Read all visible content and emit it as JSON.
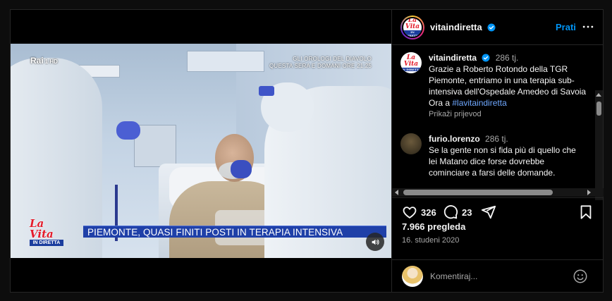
{
  "video": {
    "channel_logo": "Rai",
    "channel_suffix": "1 HD",
    "promo_line1": "GLI OROLOGI DEL DIAVOLO",
    "promo_line2": "QUESTA SERA E DOMANI ORE 21:25",
    "show_logo_word": "La Vita",
    "show_logo_sub": "IN DIRETTA",
    "banner": "PIEMONTE, QUASI FINITI POSTI IN TERAPIA INTENSIVA",
    "sound_icon": "speaker-icon"
  },
  "header": {
    "username": "vitaindiretta",
    "verified_icon": "verified-badge-icon",
    "follow_label": "Prati",
    "more_icon": "more-horizontal-icon"
  },
  "caption": {
    "username": "vitaindiretta",
    "time": "286 tj.",
    "text": "Grazie a Roberto Rotondo della TGR Piemonte, entriamo in una terapia sub-intensiva dell'Ospedale Amedeo di Savoia Ora a ",
    "hashtag": "#lavitaindiretta",
    "translate_label": "Prikaži prijevod"
  },
  "comments": [
    {
      "username": "furio.lorenzo",
      "time": "286 tj.",
      "text": "Se la gente non si fida più di quello che lei Matano dice forse dovrebbe cominciare a farsi delle domande."
    }
  ],
  "actions": {
    "likes": "326",
    "comments": "23",
    "icons": [
      "heart-icon",
      "comment-icon",
      "share-icon",
      "bookmark-icon"
    ]
  },
  "stats": {
    "views": "7.966 pregleda",
    "date": "16. studeni 2020"
  },
  "comment_box": {
    "placeholder": "Komentiraj...",
    "emoji_icon": "emoji-icon"
  },
  "colors": {
    "accent": "#0095f6",
    "hashtag": "#6fa8ff",
    "banner": "#1f40a8",
    "logo_red": "#e41c2b"
  }
}
